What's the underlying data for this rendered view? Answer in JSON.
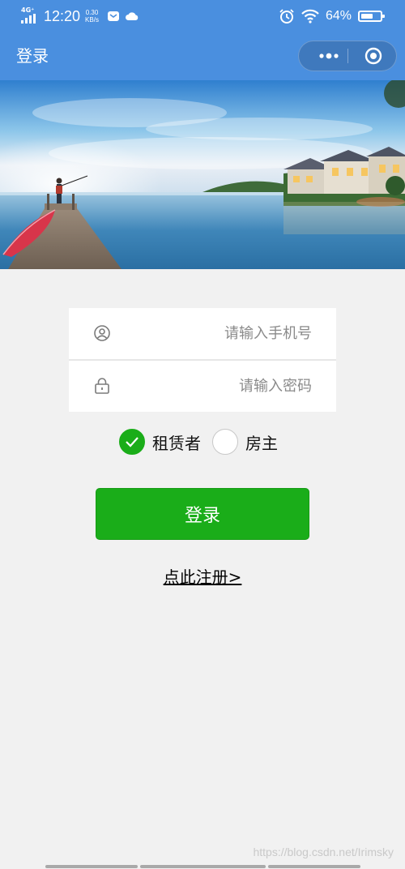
{
  "status_bar": {
    "network": "4G⁺",
    "time": "12:20",
    "speed_value": "0.30",
    "speed_unit": "KB/s",
    "battery_text": "64%",
    "battery_level": 0.64,
    "icons": [
      "signal-icon",
      "mail-icon",
      "cloud-icon",
      "alarm-icon",
      "wifi-icon",
      "battery-icon"
    ]
  },
  "nav": {
    "title": "登录",
    "icons": [
      "more-icon",
      "close-circle-icon"
    ]
  },
  "form": {
    "phone": {
      "placeholder": "请输入手机号",
      "value": "",
      "icon": "user-icon"
    },
    "password": {
      "placeholder": "请输入密码",
      "value": "",
      "icon": "lock-icon"
    }
  },
  "roles": [
    {
      "label": "租赁者",
      "checked": true
    },
    {
      "label": "房主",
      "checked": false
    }
  ],
  "login_button": "登录",
  "register_link": "点此注册>",
  "watermark": "https://blog.csdn.net/Irimsky",
  "colors": {
    "header": "#4a8fdf",
    "primary": "#1aad19",
    "background": "#f1f1f1"
  }
}
